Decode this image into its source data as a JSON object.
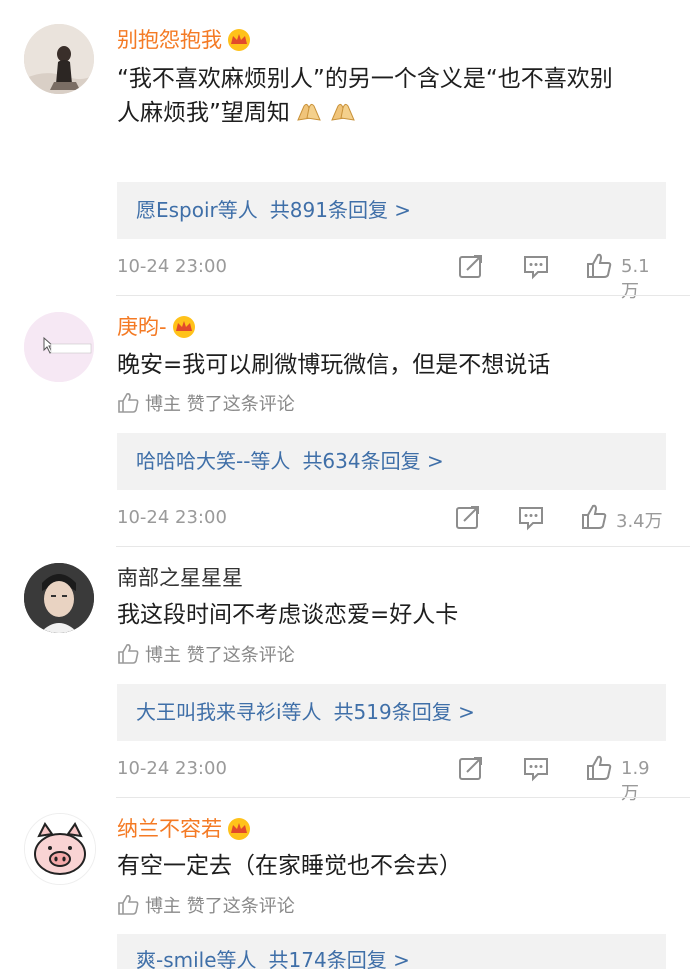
{
  "comments": [
    {
      "username": "别抱怨抱我",
      "name_color": "#f47a24",
      "verified": true,
      "text_line1": "“我不喜欢麻烦别人”的另一个含义是“也不喜欢别",
      "text_line2": "人麻烦我”望周知",
      "emoji": "pray-hands-icon",
      "liked_by_author": false,
      "reply_users": "愿Espoir等人",
      "reply_count": "共891条回复 >",
      "time": "10-24 23:00",
      "likes": "5.1万"
    },
    {
      "username": "庚昀-",
      "name_color": "#f47a24",
      "verified": true,
      "text": "晚安=我可以刷微博玩微信，但是不想说话",
      "liked_by_author": true,
      "author_like_text": "博主 赞了这条评论",
      "reply_users": "哈哈哈大笑--等人",
      "reply_count": "共634条回复 >",
      "time": "10-24 23:00",
      "likes": "3.4万"
    },
    {
      "username": "南部之星星星",
      "name_color": "#333333",
      "verified": false,
      "text": "我这段时间不考虑谈恋爱=好人卡",
      "liked_by_author": true,
      "author_like_text": "博主 赞了这条评论",
      "reply_users": "大王叫我来寻衫i等人",
      "reply_count": "共519条回复 >",
      "time": "10-24 23:00",
      "likes": "1.9万"
    },
    {
      "username": "纳兰不容若",
      "name_color": "#f47a24",
      "verified": true,
      "text": "有空一定去（在家睡觉也不会去）",
      "liked_by_author": true,
      "author_like_text": "博主 赞了这条评论",
      "reply_users": "爽-smile等人",
      "reply_count": "共174条回复 >"
    }
  ]
}
